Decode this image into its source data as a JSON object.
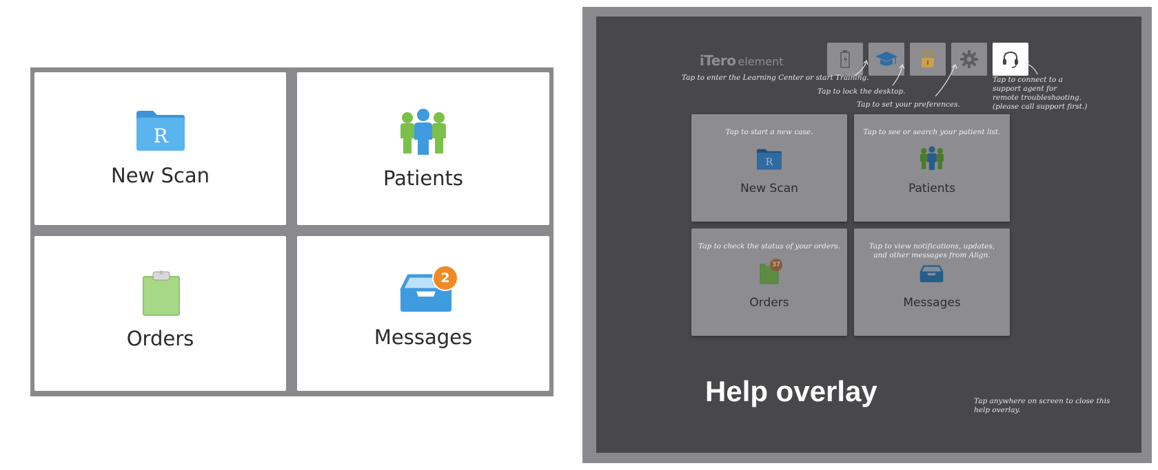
{
  "left": {
    "tiles": [
      {
        "label": "New Scan",
        "icon": "rx-folder-icon"
      },
      {
        "label": "Patients",
        "icon": "patients-icon"
      },
      {
        "label": "Orders",
        "icon": "clipboard-icon"
      },
      {
        "label": "Messages",
        "icon": "inbox-icon",
        "badge": "2"
      }
    ]
  },
  "right": {
    "brand_name": "iTero",
    "brand_suffix": "element",
    "notes": {
      "learning": "Tap to enter the Learning Center or start Training.",
      "lock": "Tap to lock the desktop.",
      "preferences": "Tap to set your preferences.",
      "support": "Tap to connect to a\nsupport agent for\nremote troubleshooting.\n(please call support first.)",
      "close": "Tap anywhere on screen to close this\nhelp overlay."
    },
    "tiles": [
      {
        "hint": "Tap to start a new case.",
        "label": "New Scan"
      },
      {
        "hint": "Tap to see or search your patient list.",
        "label": "Patients"
      },
      {
        "hint": "Tap to check the status of your orders.",
        "label": "Orders",
        "badge": "37"
      },
      {
        "hint": "Tap to view notifications, updates,\nand other messages from Align.",
        "label": "Messages"
      }
    ],
    "title": "Help overlay"
  },
  "colors": {
    "folder_blue": "#4aa8e8",
    "patients_green": "#7cc04a",
    "orders_green": "#9bd07a",
    "badge_orange": "#f08a24",
    "overlay_bg": "#48474a"
  }
}
